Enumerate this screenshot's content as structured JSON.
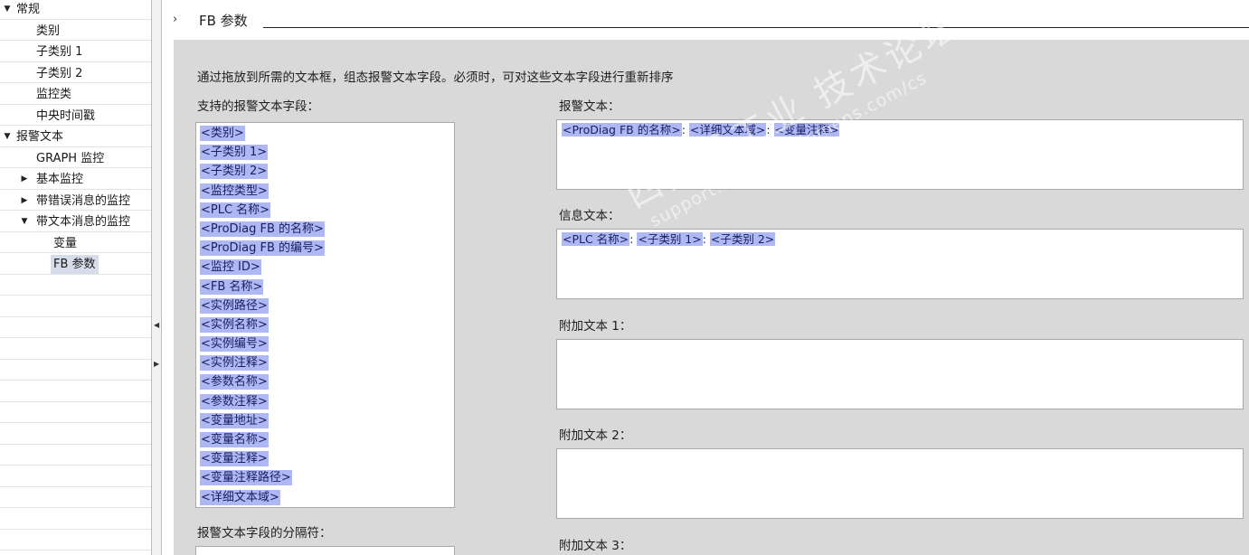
{
  "nav": {
    "items": [
      {
        "label": "常规",
        "arrow": "▼"
      },
      {
        "label": "类别",
        "arrow": ""
      },
      {
        "label": "子类别 1",
        "arrow": ""
      },
      {
        "label": "子类别 2",
        "arrow": ""
      },
      {
        "label": "监控类",
        "arrow": ""
      },
      {
        "label": "中央时间戳",
        "arrow": ""
      },
      {
        "label": "报警文本",
        "arrow": "▼"
      },
      {
        "label": "GRAPH 监控",
        "arrow": ""
      },
      {
        "label": "基本监控",
        "arrow": "▶"
      },
      {
        "label": "带错误消息的监控",
        "arrow": "▶"
      },
      {
        "label": "带文本消息的监控",
        "arrow": "▼"
      },
      {
        "label": "变量",
        "arrow": ""
      },
      {
        "label": "FB 参数",
        "arrow": ""
      }
    ]
  },
  "splitter": {
    "collapse_left": "◀",
    "expand_right": "▶"
  },
  "section": {
    "chevron": "›",
    "title": "FB 参数"
  },
  "panel": {
    "instruction": "通过拖放到所需的文本框，组态报警文本字段。必须时，可对这些文本字段进行重新排序",
    "supported_fields_label": "支持的报警文本字段：",
    "supported_fields": [
      "<类别>",
      "<子类别 1>",
      "<子类别 2>",
      "<监控类型>",
      "<PLC 名称>",
      "<ProDiag FB 的名称>",
      "<ProDiag FB 的编号>",
      "<监控 ID>",
      "<FB 名称>",
      "<实例路径>",
      "<实例名称>",
      "<实例编号>",
      "<实例注释>",
      "<参数名称>",
      "<参数注释>",
      "<变量地址>",
      "<变量名称>",
      "<变量注释>",
      "<变量注释路径>",
      "<详细文本域>"
    ],
    "separator_label": "报警文本字段的分隔符：",
    "separator_value": "",
    "alarm_text": {
      "label": "报警文本：",
      "tokens": [
        "<ProDiag FB 的名称>",
        "<详细文本域>",
        "<变量注释>"
      ]
    },
    "info_text": {
      "label": "信息文本：",
      "tokens": [
        "<PLC 名称>",
        "<子类别 1>",
        "<子类别 2>"
      ]
    },
    "extra_text_1": {
      "label": "附加文本 1："
    },
    "extra_text_2": {
      "label": "附加文本 2："
    },
    "extra_text_3": {
      "label": "附加文本 3："
    },
    "token_separator": ": "
  },
  "watermark": {
    "line1": "西门子工业 技术论坛",
    "line2": "support.industry.siemens.com/cs"
  },
  "colors": {
    "panel_bg": "#d9d9d9",
    "token_bg": "#aeb9f3",
    "selected_nav_bg": "#d6dcea"
  }
}
